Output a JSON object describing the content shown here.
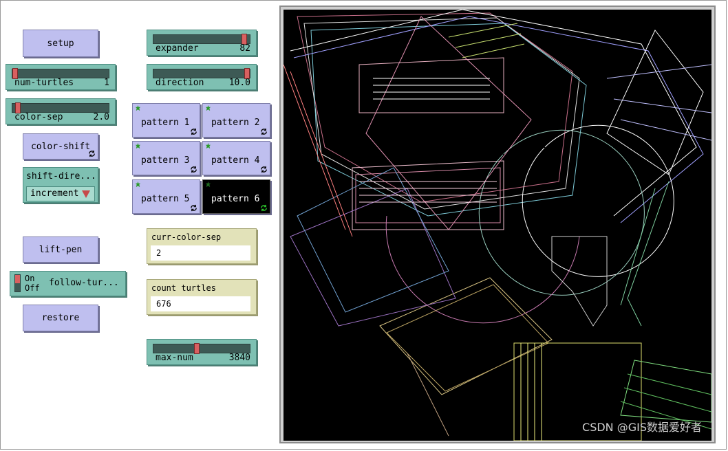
{
  "buttons": {
    "setup": "setup",
    "color_shift": "color-shift",
    "lift_pen": "lift-pen",
    "restore": "restore",
    "pattern1": "pattern 1",
    "pattern2": "pattern 2",
    "pattern3": "pattern 3",
    "pattern4": "pattern 4",
    "pattern5": "pattern 5",
    "pattern6": "pattern 6"
  },
  "sliders": {
    "num_turtles": {
      "name": "num-turtles",
      "value": "1",
      "fraction": 0.0
    },
    "color_sep": {
      "name": "color-sep",
      "value": "2.0",
      "fraction": 0.03
    },
    "expander": {
      "name": "expander",
      "value": "82",
      "fraction": 0.97
    },
    "direction": {
      "name": "direction",
      "value": "10.0",
      "fraction": 1.0
    },
    "max_num": {
      "name": "max-num",
      "value": "3840",
      "fraction": 0.45
    }
  },
  "chooser": {
    "name": "shift-dire...",
    "value": "increment"
  },
  "switch": {
    "name": "follow-tur...",
    "on_label": "On",
    "off_label": "Off",
    "state": "off"
  },
  "monitors": {
    "curr_color_sep": {
      "name": "curr-color-sep",
      "value": "2"
    },
    "count_turtles": {
      "name": "count turtles",
      "value": "676"
    }
  },
  "watermark": "CSDN @GIS数据爱好者",
  "colors": {
    "button": "#bfbfef",
    "slider": "#7ec0b2",
    "monitor": "#e2e2b9",
    "view_bg": "#000000"
  }
}
